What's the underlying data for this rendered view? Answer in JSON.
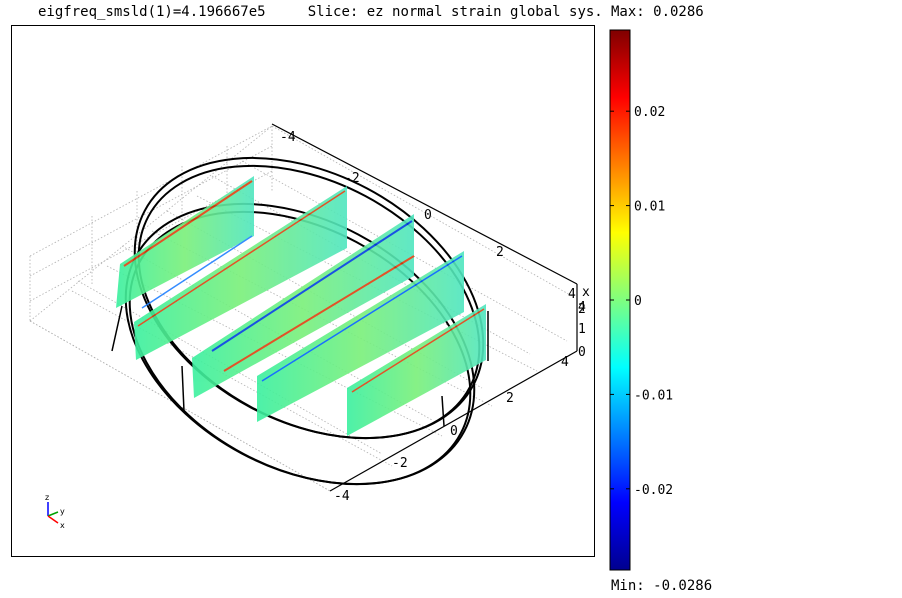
{
  "title_left": "eigfreq_smsld(1)=4.196667e5",
  "title_right": "Slice: ez normal strain global sys.",
  "chart_data": {
    "type": "heatmap",
    "colorbar": {
      "max_label": "Max: 0.0286",
      "min_label": "Min: -0.0286",
      "vmin": -0.0286,
      "vmax": 0.0286,
      "colormap": "jet",
      "ticks": [
        0.02,
        0.01,
        0,
        -0.01,
        -0.02
      ],
      "tick_labels": [
        "0.02",
        "0.01",
        "0",
        "-0.01",
        "-0.02"
      ]
    },
    "axes": {
      "x_ticks": [
        "-4",
        "-2",
        "0",
        "2",
        "4"
      ],
      "y_ticks": [
        "-4",
        "-2",
        "0",
        "2",
        "4"
      ],
      "z_ticks": [
        "0",
        "1",
        "2",
        "4"
      ],
      "x_label": "x",
      "grid": true
    },
    "triad": {
      "labels": [
        "z",
        "y",
        "x"
      ]
    },
    "slices": {
      "count": 5,
      "positions": [
        -4,
        -2,
        0,
        2,
        4
      ]
    }
  }
}
